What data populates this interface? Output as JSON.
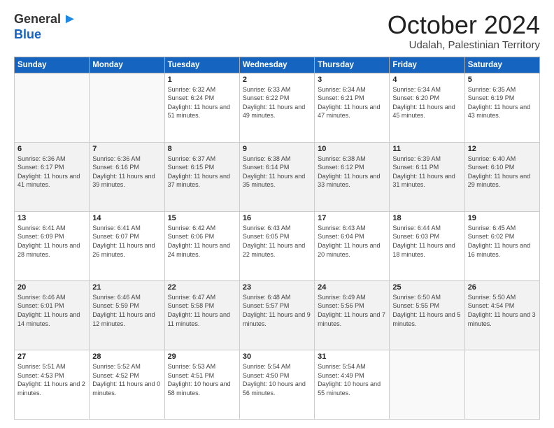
{
  "logo": {
    "general": "General",
    "blue": "Blue"
  },
  "header": {
    "month": "October 2024",
    "location": "Udalah, Palestinian Territory"
  },
  "weekdays": [
    "Sunday",
    "Monday",
    "Tuesday",
    "Wednesday",
    "Thursday",
    "Friday",
    "Saturday"
  ],
  "weeks": [
    [
      {
        "day": "",
        "info": ""
      },
      {
        "day": "",
        "info": ""
      },
      {
        "day": "1",
        "info": "Sunrise: 6:32 AM\nSunset: 6:24 PM\nDaylight: 11 hours and 51 minutes."
      },
      {
        "day": "2",
        "info": "Sunrise: 6:33 AM\nSunset: 6:22 PM\nDaylight: 11 hours and 49 minutes."
      },
      {
        "day": "3",
        "info": "Sunrise: 6:34 AM\nSunset: 6:21 PM\nDaylight: 11 hours and 47 minutes."
      },
      {
        "day": "4",
        "info": "Sunrise: 6:34 AM\nSunset: 6:20 PM\nDaylight: 11 hours and 45 minutes."
      },
      {
        "day": "5",
        "info": "Sunrise: 6:35 AM\nSunset: 6:19 PM\nDaylight: 11 hours and 43 minutes."
      }
    ],
    [
      {
        "day": "6",
        "info": "Sunrise: 6:36 AM\nSunset: 6:17 PM\nDaylight: 11 hours and 41 minutes."
      },
      {
        "day": "7",
        "info": "Sunrise: 6:36 AM\nSunset: 6:16 PM\nDaylight: 11 hours and 39 minutes."
      },
      {
        "day": "8",
        "info": "Sunrise: 6:37 AM\nSunset: 6:15 PM\nDaylight: 11 hours and 37 minutes."
      },
      {
        "day": "9",
        "info": "Sunrise: 6:38 AM\nSunset: 6:14 PM\nDaylight: 11 hours and 35 minutes."
      },
      {
        "day": "10",
        "info": "Sunrise: 6:38 AM\nSunset: 6:12 PM\nDaylight: 11 hours and 33 minutes."
      },
      {
        "day": "11",
        "info": "Sunrise: 6:39 AM\nSunset: 6:11 PM\nDaylight: 11 hours and 31 minutes."
      },
      {
        "day": "12",
        "info": "Sunrise: 6:40 AM\nSunset: 6:10 PM\nDaylight: 11 hours and 29 minutes."
      }
    ],
    [
      {
        "day": "13",
        "info": "Sunrise: 6:41 AM\nSunset: 6:09 PM\nDaylight: 11 hours and 28 minutes."
      },
      {
        "day": "14",
        "info": "Sunrise: 6:41 AM\nSunset: 6:07 PM\nDaylight: 11 hours and 26 minutes."
      },
      {
        "day": "15",
        "info": "Sunrise: 6:42 AM\nSunset: 6:06 PM\nDaylight: 11 hours and 24 minutes."
      },
      {
        "day": "16",
        "info": "Sunrise: 6:43 AM\nSunset: 6:05 PM\nDaylight: 11 hours and 22 minutes."
      },
      {
        "day": "17",
        "info": "Sunrise: 6:43 AM\nSunset: 6:04 PM\nDaylight: 11 hours and 20 minutes."
      },
      {
        "day": "18",
        "info": "Sunrise: 6:44 AM\nSunset: 6:03 PM\nDaylight: 11 hours and 18 minutes."
      },
      {
        "day": "19",
        "info": "Sunrise: 6:45 AM\nSunset: 6:02 PM\nDaylight: 11 hours and 16 minutes."
      }
    ],
    [
      {
        "day": "20",
        "info": "Sunrise: 6:46 AM\nSunset: 6:01 PM\nDaylight: 11 hours and 14 minutes."
      },
      {
        "day": "21",
        "info": "Sunrise: 6:46 AM\nSunset: 5:59 PM\nDaylight: 11 hours and 12 minutes."
      },
      {
        "day": "22",
        "info": "Sunrise: 6:47 AM\nSunset: 5:58 PM\nDaylight: 11 hours and 11 minutes."
      },
      {
        "day": "23",
        "info": "Sunrise: 6:48 AM\nSunset: 5:57 PM\nDaylight: 11 hours and 9 minutes."
      },
      {
        "day": "24",
        "info": "Sunrise: 6:49 AM\nSunset: 5:56 PM\nDaylight: 11 hours and 7 minutes."
      },
      {
        "day": "25",
        "info": "Sunrise: 6:50 AM\nSunset: 5:55 PM\nDaylight: 11 hours and 5 minutes."
      },
      {
        "day": "26",
        "info": "Sunrise: 5:50 AM\nSunset: 4:54 PM\nDaylight: 11 hours and 3 minutes."
      }
    ],
    [
      {
        "day": "27",
        "info": "Sunrise: 5:51 AM\nSunset: 4:53 PM\nDaylight: 11 hours and 2 minutes."
      },
      {
        "day": "28",
        "info": "Sunrise: 5:52 AM\nSunset: 4:52 PM\nDaylight: 11 hours and 0 minutes."
      },
      {
        "day": "29",
        "info": "Sunrise: 5:53 AM\nSunset: 4:51 PM\nDaylight: 10 hours and 58 minutes."
      },
      {
        "day": "30",
        "info": "Sunrise: 5:54 AM\nSunset: 4:50 PM\nDaylight: 10 hours and 56 minutes."
      },
      {
        "day": "31",
        "info": "Sunrise: 5:54 AM\nSunset: 4:49 PM\nDaylight: 10 hours and 55 minutes."
      },
      {
        "day": "",
        "info": ""
      },
      {
        "day": "",
        "info": ""
      }
    ]
  ]
}
